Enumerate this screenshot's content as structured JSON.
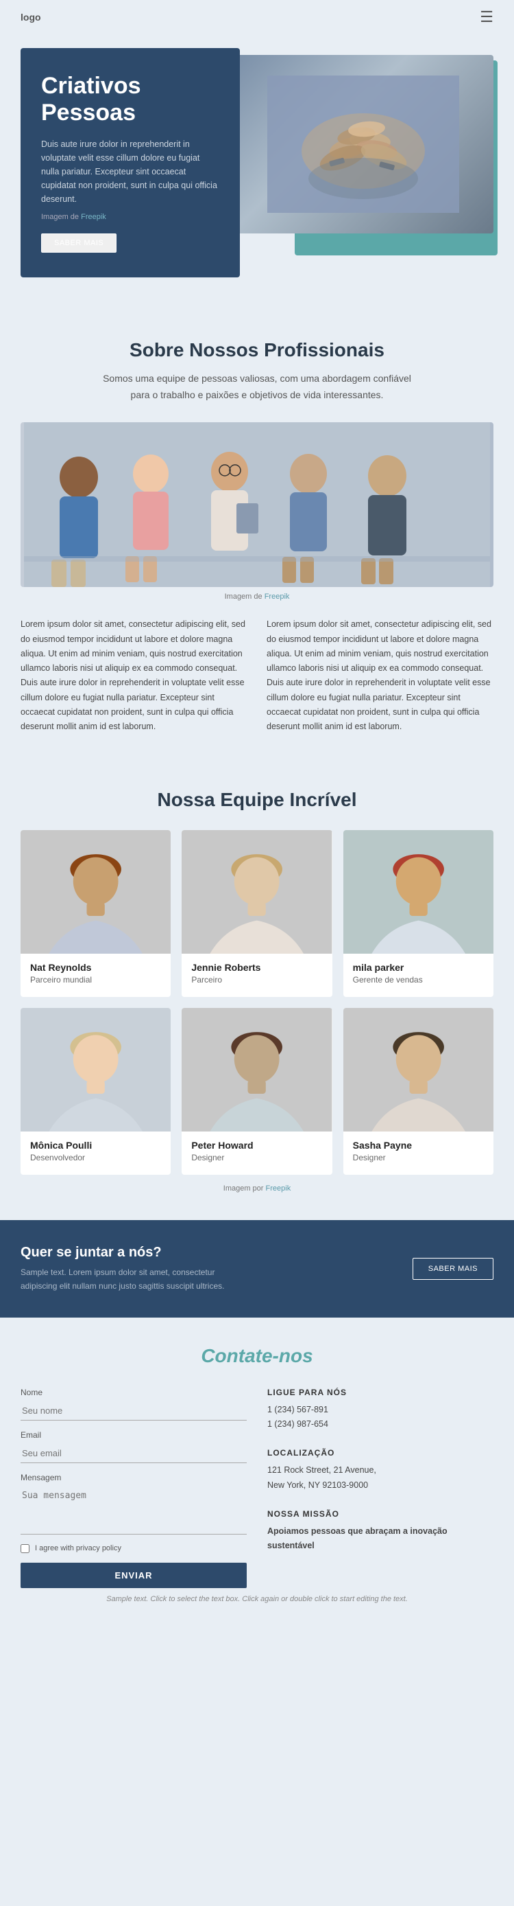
{
  "nav": {
    "logo": "logo",
    "menu_icon": "☰"
  },
  "hero": {
    "title_line1": "Criativos",
    "title_line2": "Pessoas",
    "description": "Duis aute irure dolor in reprehenderit in voluptate velit esse cillum dolore eu fugiat nulla pariatur. Excepteur sint occaecat cupidatat non proident, sunt in culpa qui officia deserunt.",
    "img_credit_prefix": "Imagem de",
    "img_credit_link": "Freepik",
    "btn_label": "SABER MAIS"
  },
  "about": {
    "title": "Sobre Nossos Profissionais",
    "subtitle": "Somos uma equipe de pessoas valiosas, com uma abordagem confiável para o trabalho e paixões e objetivos de vida interessantes.",
    "photo_caption_prefix": "Imagem de",
    "photo_caption_link": "Freepik",
    "col1_text": "Lorem ipsum dolor sit amet, consectetur adipiscing elit, sed do eiusmod tempor incididunt ut labore et dolore magna aliqua. Ut enim ad minim veniam, quis nostrud exercitation ullamco laboris nisi ut aliquip ex ea commodo consequat. Duis aute irure dolor in reprehenderit in voluptate velit esse cillum dolore eu fugiat nulla pariatur. Excepteur sint occaecat cupidatat non proident, sunt in culpa qui officia deserunt mollit anim id est laborum.",
    "col2_text": "Lorem ipsum dolor sit amet, consectetur adipiscing elit, sed do eiusmod tempor incididunt ut labore et dolore magna aliqua. Ut enim ad minim veniam, quis nostrud exercitation ullamco laboris nisi ut aliquip ex ea commodo consequat. Duis aute irure dolor in reprehenderit in voluptate velit esse cillum dolore eu fugiat nulla pariatur. Excepteur sint occaecat cupidatat non proident, sunt in culpa qui officia deserunt mollit anim id est laborum."
  },
  "team": {
    "title": "Nossa Equipe Incrível",
    "caption_prefix": "Imagem por",
    "caption_link": "Freepik",
    "members": [
      {
        "name": "Nat Reynolds",
        "role": "Parceiro mundial",
        "photo_class": "photo-warm1"
      },
      {
        "name": "Jennie Roberts",
        "role": "Parceiro",
        "photo_class": "photo-warm2"
      },
      {
        "name": "mila parker",
        "role": "Gerente de vendas",
        "photo_class": "photo-teal"
      },
      {
        "name": "Mônica Poulli",
        "role": "Desenvolvedor",
        "photo_class": "photo-cool1"
      },
      {
        "name": "Peter Howard",
        "role": "Designer",
        "photo_class": "photo-cool2"
      },
      {
        "name": "Sasha Payne",
        "role": "Designer",
        "photo_class": "photo-warm3"
      }
    ]
  },
  "cta": {
    "title": "Quer se juntar a nós?",
    "description": "Sample text. Lorem ipsum dolor sit amet, consectetur adipiscing elit nullam nunc justo sagittis suscipit ultrices.",
    "btn_label": "SABER MAIS"
  },
  "contact": {
    "title": "Contate-nos",
    "form": {
      "name_label": "Nome",
      "name_placeholder": "Seu nome",
      "email_label": "Email",
      "email_placeholder": "Seu email",
      "message_label": "Mensagem",
      "message_placeholder": "Sua mensagem",
      "checkbox_label": "I agree with privacy policy",
      "submit_label": "ENVIAR"
    },
    "info": {
      "phone_title": "LIGUE PARA NÓS",
      "phone1": "1 (234) 567-891",
      "phone2": "1 (234) 987-654",
      "location_title": "LOCALIZAÇÃO",
      "address": "121 Rock Street, 21 Avenue,\nNew York, NY 92103-9000",
      "mission_title": "NOSSA MISSÃO",
      "mission_text": "Apoiamos pessoas que abraçam a inovação sustentável"
    }
  },
  "sample_text": "Sample text. Click to select the text box. Click again or double click to start editing the text."
}
